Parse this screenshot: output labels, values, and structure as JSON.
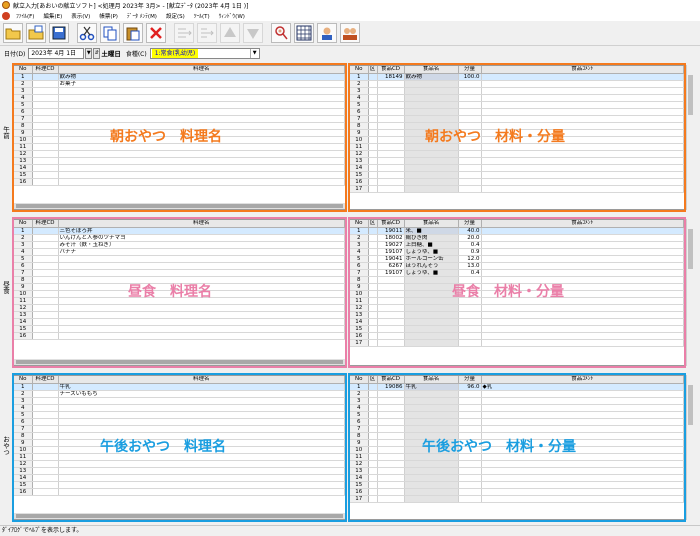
{
  "window": {
    "title": "献立入力[あおいの献立ソフト] <処理月 2023年 3月> - [献立ﾃﾞｰﾀ (2023年 4月 1日 )]"
  },
  "menu": {
    "items": [
      "ﾌｧｲﾙ(F)",
      "編集(E)",
      "表示(V)",
      "帳票(P)",
      "ﾃﾞｰﾀ ﾒﾝﾃ(M)",
      "設定(S)",
      "ﾂｰﾙ(T)",
      "ｳｨﾝﾄﾞｳ(W)"
    ]
  },
  "toolbar": {
    "buttons": [
      "open-folder-icon",
      "open-file-icon",
      "save-icon",
      "cut-icon",
      "copy-icon",
      "paste-icon",
      "delete-icon",
      "insert-row-icon",
      "insert-row-alt-icon",
      "up-icon",
      "down-icon",
      "search-person-icon",
      "grid-icon",
      "user-edit-icon",
      "users-icon"
    ]
  },
  "dateRow": {
    "dateLabel": "日付(D)",
    "date": "2023年 4月 1日",
    "spinLabel": "▼",
    "weekday": "土曜日",
    "mealLabel": "食種(C)",
    "meal": "1:常食(乳幼児)"
  },
  "columns": {
    "left": [
      "No",
      "料理CD",
      "料理名"
    ],
    "right": [
      "No",
      "区",
      "食品CD",
      "食品名",
      "分量",
      "食品ｺﾒﾝﾄ"
    ]
  },
  "sections": [
    {
      "sideLabel": "午前",
      "overlayLeft": "朝おやつ　料理名",
      "overlayRight": "朝おやつ　材料・分量",
      "color": "#f47a1e",
      "dishes": [
        {
          "no": "1",
          "cd": "",
          "name": "飲み物"
        },
        {
          "no": "2",
          "cd": "",
          "name": "お菓子"
        }
      ],
      "leftRowCount": 16,
      "ingredients": [
        {
          "no": "1",
          "ku": "",
          "cd": "18149",
          "name": "飲み物",
          "qty": "100.0",
          "comment": ""
        }
      ],
      "rightRowCount": 17
    },
    {
      "sideLabel": "昼食",
      "overlayLeft": "昼食　料理名",
      "overlayRight": "昼食　材料・分量",
      "color": "#ea7fa8",
      "dishes": [
        {
          "no": "1",
          "cd": "",
          "name": "三色そぼろ丼"
        },
        {
          "no": "2",
          "cd": "",
          "name": "いんげんと人参のツナマヨ"
        },
        {
          "no": "3",
          "cd": "",
          "name": "みそ汁（麩・玉ねぎ）"
        },
        {
          "no": "4",
          "cd": "",
          "name": "バナナ"
        }
      ],
      "leftRowCount": 16,
      "ingredients": [
        {
          "no": "1",
          "ku": "",
          "cd": "19011",
          "name": "米、■",
          "qty": "40.0",
          "comment": ""
        },
        {
          "no": "2",
          "cd": "18002",
          "ku": "",
          "name": "鶏ひき肉",
          "qty": "20.0",
          "comment": ""
        },
        {
          "no": "3",
          "ku": "",
          "cd": "19027",
          "name": "上白糖、■",
          "qty": "0.4",
          "comment": ""
        },
        {
          "no": "4",
          "ku": "",
          "cd": "19107",
          "name": "しょうゆ、■",
          "qty": "0.9",
          "comment": ""
        },
        {
          "no": "5",
          "ku": "",
          "cd": "19041",
          "name": "ホールコーン缶",
          "qty": "12.0",
          "comment": ""
        },
        {
          "no": "6",
          "ku": "",
          "cd": "6267",
          "name": "ほうれんそう",
          "qty": "13.0",
          "comment": ""
        },
        {
          "no": "7",
          "ku": "",
          "cd": "19107",
          "name": "しょうゆ、■",
          "qty": "0.4",
          "comment": ""
        }
      ],
      "rightRowCount": 17
    },
    {
      "sideLabel": "おやつ",
      "overlayLeft": "午後おやつ　料理名",
      "overlayRight": "午後おやつ　材料・分量",
      "color": "#1a9ee0",
      "dishes": [
        {
          "no": "1",
          "cd": "",
          "name": "牛乳"
        },
        {
          "no": "2",
          "cd": "",
          "name": "チーズいももち"
        }
      ],
      "leftRowCount": 16,
      "ingredients": [
        {
          "no": "1",
          "ku": "",
          "cd": "19086",
          "name": "牛乳",
          "qty": "96.0",
          "comment": "◆乳"
        }
      ],
      "rightRowCount": 17
    }
  ],
  "status": {
    "text": "ﾀﾞｲｱﾛｸﾞでﾍﾙﾌﾟを表示します。"
  }
}
